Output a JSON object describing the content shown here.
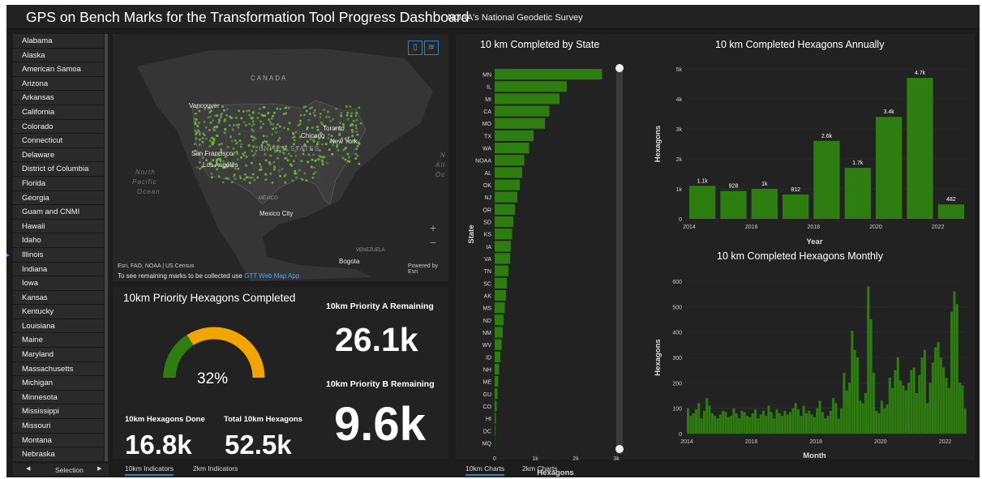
{
  "header": {
    "title": "GPS on Bench Marks for the Transformation Tool Progress Dashboard",
    "subtitle": "NOAA's National Geodetic Survey"
  },
  "state_list": {
    "items": [
      "Alabama",
      "Alaska",
      "American Samoa",
      "Arizona",
      "Arkansas",
      "California",
      "Colorado",
      "Connecticut",
      "Delaware",
      "District of Columbia",
      "Florida",
      "Georgia",
      "Guam and CNMI",
      "Hawaii",
      "Idaho",
      "Illinois",
      "Indiana",
      "Iowa",
      "Kansas",
      "Kentucky",
      "Louisiana",
      "Maine",
      "Maryland",
      "Massachusetts",
      "Michigan",
      "Minnesota",
      "Mississippi",
      "Missouri",
      "Montana",
      "Nebraska"
    ],
    "footer_label": "Selection",
    "prev_icon": "◀",
    "next_icon": "▶"
  },
  "map": {
    "labels": {
      "canada": "CANADA",
      "vancouver": "Vancouver",
      "toronto": "Toronto",
      "chicago": "Chicago",
      "newyork": "New York",
      "sanfrancisco": "San Francisco",
      "losangeles": "Los Angeles",
      "unitedstates": "UNITED STATES",
      "mexico": "MÉXICO",
      "mexicocity": "Mexico City",
      "venezuela": "VENEZUELA",
      "bogota": "Bogota",
      "north_pacific_1": "North",
      "north_pacific_2": "Pacific",
      "north_pacific_3": "Ocean",
      "atlantic_1": "N",
      "atlantic_2": "Atl",
      "atlantic_3": "Oc"
    },
    "attribution": "Esri, FAO, NOAA | US Census",
    "powered_by": "Powered by Esri",
    "note_prefix": "To see remaining marks to be collected use",
    "note_link": "GTT Web Map App",
    "zoom_in": "+",
    "zoom_out": "−",
    "bookmark_icon": "bookmark-icon",
    "layers_icon": "layers-icon"
  },
  "indicators": {
    "gauge_title": "10km Priority Hexagons Completed",
    "gauge_value": "32%",
    "gauge_fraction": 0.32,
    "done_title": "10km Hexagons Done",
    "done_value": "16.8k",
    "total_title": "Total 10km Hexagons",
    "total_value": "52.5k",
    "a_title": "10km Priority A Remaining",
    "a_value": "26.1k",
    "b_title": "10km Priority B Remaining",
    "b_value": "9.6k"
  },
  "tabs": {
    "left": [
      "10km Indicators",
      "2km Indicators"
    ],
    "right": [
      "10km Charts",
      "2km Charts"
    ]
  },
  "colors": {
    "bar": "#2e7d10",
    "gauge_done": "#2e7d10",
    "gauge_remaining": "#f0a500",
    "link": "#4aa3ff",
    "map_land": "#3c3c3c",
    "map_hex": "#6bbf3a"
  },
  "chart_data": [
    {
      "type": "bar",
      "orientation": "horizontal",
      "title": "10 km Completed by State",
      "xlabel": "Hexagons",
      "ylabel": "State",
      "categories": [
        "MN",
        "IL",
        "MI",
        "CA",
        "MO",
        "TX",
        "WA",
        "NOAA",
        "AL",
        "OK",
        "NJ",
        "OR",
        "SD",
        "KS",
        "IA",
        "VA",
        "TN",
        "SC",
        "AK",
        "MS",
        "ND",
        "NM",
        "WV",
        "ID",
        "NH",
        "ME",
        "GU",
        "CO",
        "HI",
        "DC",
        "MQ"
      ],
      "values": [
        2650,
        1780,
        1600,
        1350,
        1240,
        960,
        850,
        730,
        680,
        620,
        560,
        500,
        460,
        430,
        400,
        380,
        340,
        300,
        280,
        250,
        220,
        200,
        170,
        140,
        110,
        90,
        70,
        50,
        30,
        15,
        5
      ],
      "xticks": [
        "0",
        "1k",
        "2k",
        "3k"
      ],
      "xlim": [
        0,
        3000
      ]
    },
    {
      "type": "bar",
      "title": "10 km Completed Hexagons Annually",
      "xlabel": "Year",
      "ylabel": "Hexagons",
      "categories": [
        "2014",
        "2015",
        "2016",
        "2017",
        "2018",
        "2019",
        "2020",
        "2021",
        "2022"
      ],
      "values": [
        1100,
        928,
        1000,
        812,
        2600,
        1700,
        3400,
        4700,
        482
      ],
      "data_labels": [
        "1.1k",
        "928",
        "1k",
        "812",
        "2.6k",
        "1.7k",
        "3.4k",
        "4.7k",
        "482"
      ],
      "yticks": [
        "0",
        "1k",
        "2k",
        "3k",
        "4k",
        "5k"
      ],
      "xticks": [
        "2014",
        "2016",
        "2018",
        "2020",
        "2022"
      ],
      "ylim": [
        0,
        5000
      ]
    },
    {
      "type": "bar",
      "title": "10 km Completed Hexagons Monthly",
      "xlabel": "Month",
      "ylabel": "Hexagons",
      "x_start": "2014-01",
      "x_end": "2022-06",
      "values": [
        100,
        70,
        80,
        95,
        120,
        60,
        90,
        140,
        110,
        80,
        70,
        60,
        75,
        90,
        85,
        65,
        70,
        100,
        80,
        60,
        90,
        85,
        70,
        65,
        80,
        95,
        60,
        75,
        90,
        70,
        110,
        85,
        60,
        95,
        80,
        70,
        90,
        75,
        85,
        100,
        120,
        95,
        70,
        110,
        80,
        90,
        75,
        65,
        100,
        130,
        85,
        60,
        70,
        90,
        140,
        120,
        60,
        100,
        240,
        170,
        200,
        405,
        330,
        300,
        130,
        120,
        160,
        580,
        450,
        240,
        90,
        80,
        130,
        100,
        115,
        220,
        180,
        250,
        300,
        210,
        190,
        170,
        200,
        250,
        260,
        160,
        230,
        300,
        330,
        120,
        200,
        280,
        340,
        360,
        300,
        260,
        220,
        180,
        480,
        560,
        510,
        200,
        190,
        100
      ],
      "yticks": [
        "0",
        "100",
        "200",
        "300",
        "400",
        "500",
        "600"
      ],
      "xticks": [
        "2014",
        "2016",
        "2018",
        "2020",
        "2022"
      ],
      "ylim": [
        0,
        600
      ]
    }
  ]
}
